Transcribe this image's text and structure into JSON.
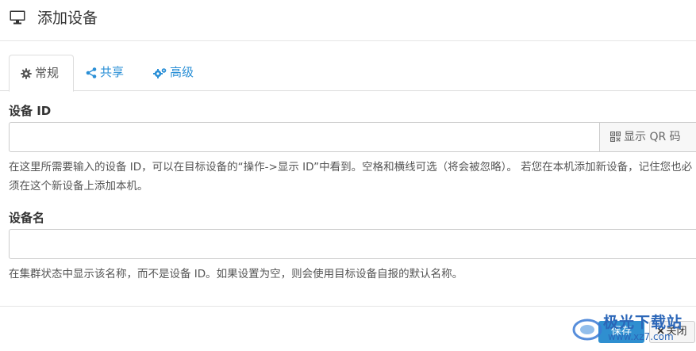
{
  "dialog": {
    "title": "添加设备",
    "header_icon": "monitor-icon"
  },
  "tabs": [
    {
      "label": "常规",
      "icon": "gear-icon",
      "active": true
    },
    {
      "label": "共享",
      "icon": "share-icon",
      "active": false
    },
    {
      "label": "高级",
      "icon": "cogs-icon",
      "active": false
    }
  ],
  "device_id": {
    "label": "设备 ID",
    "value": "",
    "addon_label": "显示 QR 码",
    "addon_icon": "qrcode-icon",
    "help": "在这里所需要输入的设备 ID，可以在目标设备的“操作->显示 ID”中看到。空格和横线可选（将会被忽略）。 若您在本机添加新设备，记住您也必须在这个新设备上添加本机。"
  },
  "device_name": {
    "label": "设备名",
    "value": "",
    "help": "在集群状态中显示该名称，而不是设备 ID。如果设置为空，则会使用目标设备自报的默认名称。"
  },
  "footer": {
    "save_label": "保存",
    "close_label": "关闭",
    "close_icon": "close-icon"
  },
  "watermark": {
    "brand": "极光下载站",
    "url": "www.xz7.com"
  },
  "colors": {
    "accent": "#2a8fd6",
    "primary_button": "#2f8fd0",
    "border": "#cccccc"
  }
}
